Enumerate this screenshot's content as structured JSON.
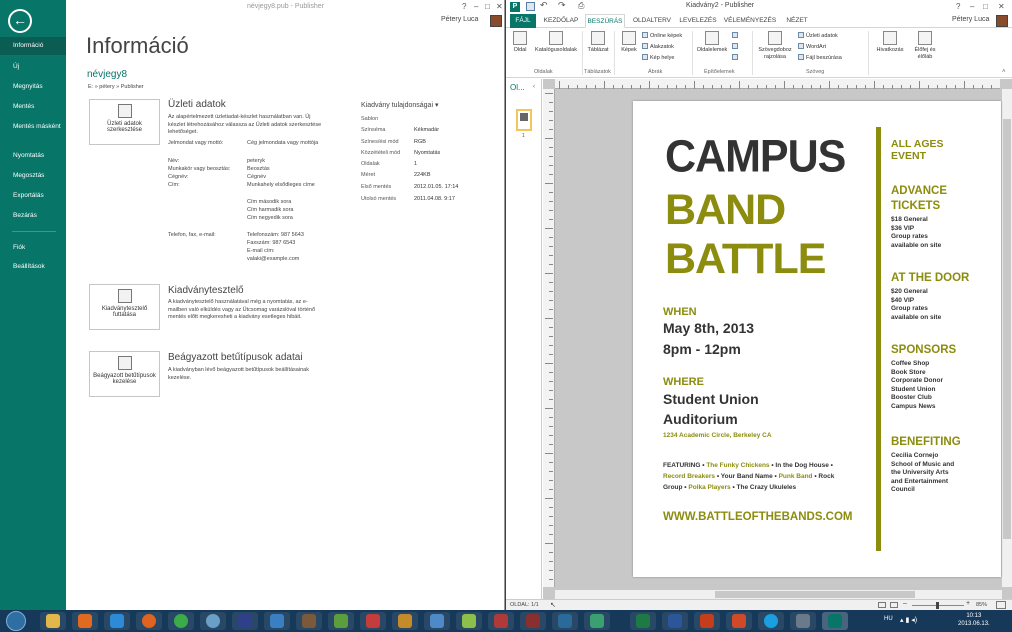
{
  "left_window": {
    "title": "névjegy8.pub - Publisher",
    "user": "Pétery Luca",
    "nav_items": [
      "Információ",
      "Új",
      "Megnyitás",
      "Mentés",
      "Mentés másként",
      "Nyomtatás",
      "Megosztás",
      "Exportálás",
      "Bezárás",
      "Fiók",
      "Beállítások"
    ],
    "heading": "Információ",
    "doc_name": "névjegy8",
    "doc_path": "E: » pétery » Publisher",
    "business": {
      "button": "Üzleti adatok szerkesztése",
      "title": "Üzleti adatok",
      "desc": "Az alapértelmezett üzletiadat-készlet használatban van. Új készlet létrehozásához válassza az Üzleti adatok szerkesztése lehetőséget.",
      "rows": [
        {
          "label": "Jelmondat vagy mottó:",
          "value": "Cég jelmondata vagy mottója"
        },
        {
          "label": "Név:",
          "value": "peteryk"
        },
        {
          "label": "Munkakör vagy beosztás:",
          "value": "Beosztás"
        },
        {
          "label": "Cégnév:",
          "value": "Cégnév"
        },
        {
          "label": "Cím:",
          "value": "Munkahely elsődleges címe"
        },
        {
          "label": "",
          "value": "Cím második sora"
        },
        {
          "label": "",
          "value": "Cím harmadik sora"
        },
        {
          "label": "",
          "value": "Cím negyedik sora"
        },
        {
          "label": "Telefon, fax, e-mail:",
          "value": "Telefonszám: 987 5643"
        },
        {
          "label": "",
          "value": "Faxszám: 987 6543"
        },
        {
          "label": "",
          "value": "E-mail cím: valaki@example.com"
        }
      ]
    },
    "properties": {
      "title": "Kiadvány tulajdonságai ▾",
      "rows": [
        {
          "label": "Sablon",
          "value": ""
        },
        {
          "label": "Színséma",
          "value": "Kékmadár"
        },
        {
          "label": "Színes/ési mód",
          "value": "RGB"
        },
        {
          "label": "Közzétételi mód",
          "value": "Nyomtatás"
        },
        {
          "label": "Oldalak",
          "value": "1"
        },
        {
          "label": "Méret",
          "value": "224KB"
        },
        {
          "label": "Első mentés",
          "value": "2012.01.05. 17:14"
        },
        {
          "label": "Utolsó mentés",
          "value": "2011.04.08. 9:17"
        }
      ]
    },
    "checker": {
      "button": "Kiadványtesztelő futtatása",
      "title": "Kiadványtesztelő",
      "desc": "A kiadványtesztelő használatával még a nyomtatás, az e-mailben való elküldés vagy az Ütcsomag varázslóval történő mentés előtt megkeresheti a kiadvány esetleges hibáit."
    },
    "fonts": {
      "button": "Beágyazott betűtípusok kezelése",
      "title": "Beágyazott betűtípusok adatai",
      "desc": "A kiadványban lévő beágyazott betűtípusok beállításainak kezelése."
    }
  },
  "right_window": {
    "title": "Kiadvány2 - Publisher",
    "user": "Pétery Luca",
    "tabs": [
      "FÁJL",
      "KEZDŐLAP",
      "BESZÚRÁS",
      "OLDALTERV",
      "LEVELEZÉS",
      "VÉLEMÉNYEZÉS",
      "NÉZET"
    ],
    "active_tab": "BESZÚRÁS",
    "ribbon": {
      "oldal": "Oldal",
      "katalogus": "Katalógusoldalak",
      "tablazat": "Táblázat",
      "kepek": "Képek",
      "online_kepek": "Online képek",
      "alakzatok": "Alakzatok",
      "kep_helye": "Kép helye",
      "oldalelemek": "Oldalelemek",
      "szovegdoboz": "Szövegdoboz rajzolása",
      "uzleti_adatok": "Üzleti adatok",
      "wordart": "WordArt",
      "fajl_beszurasa": "Fájl beszúrása",
      "hivatkozas": "Hivatkozás",
      "elofej": "Élőfej és élőláb",
      "groups": [
        "Oldalak",
        "Táblázatok",
        "Ábrák",
        "Építőelemek",
        "Szöveg"
      ]
    },
    "pages_label": "Ol...",
    "page_number": "1",
    "status": "OLDAL: 1/1",
    "zoom": "85%",
    "poster": {
      "title1": "CAMPUS",
      "title2": "BAND",
      "title3": "BATTLE",
      "when_label": "WHEN",
      "when_date": "May 8th, 2013",
      "when_time": "8pm - 12pm",
      "where_label": "WHERE",
      "where_place1": "Student Union",
      "where_place2": "Auditorium",
      "where_addr": "1234 Academic Circle, Berkeley CA",
      "featuring_label": "FEATURING •",
      "featuring": [
        {
          "text": " The Funky Chickens",
          "olive": true
        },
        {
          "text": " • In the Dog House •",
          "olive": false
        },
        {
          "text": "Record Breakers",
          "olive": true
        },
        {
          "text": " • Your Band Name • ",
          "olive": false
        },
        {
          "text": "Punk Band",
          "olive": true
        },
        {
          "text": " • Rock",
          "olive": false
        }
      ],
      "featuring_line2a": "Group • ",
      "featuring_line2b": "Polka Players",
      "featuring_line2c": " • The Crazy Ukuleles",
      "website": "WWW.BATTLEOFTHEBANDS.COM",
      "sidebar": {
        "all_ages1": "ALL AGES",
        "all_ages2": "EVENT",
        "advance1": "ADVANCE",
        "advance2": "TICKETS",
        "advance_lines": [
          "$18 General",
          "$36 VIP",
          "Group rates",
          "available on site"
        ],
        "door": "AT THE DOOR",
        "door_lines": [
          "$20 General",
          "$40 VIP",
          "Group rates",
          "available on site"
        ],
        "sponsors": "SPONSORS",
        "sponsor_lines": [
          "Coffee Shop",
          "Book Store",
          "Corporate Donor",
          "Student Union",
          "Booster Club",
          "Campus News"
        ],
        "benefiting": "BENEFITING",
        "benefiting_lines": [
          "Cecilia Cornejo",
          "School of Music and",
          "the University Arts",
          "and Entertainment",
          "Council"
        ]
      }
    }
  },
  "taskbar": {
    "lang": "HU",
    "time": "10:13",
    "date": "2013.06.13."
  },
  "colors": {
    "teal": "#077568",
    "olive": "#8c8c0f",
    "dark": "#333333",
    "taskbar": "#16395a"
  }
}
